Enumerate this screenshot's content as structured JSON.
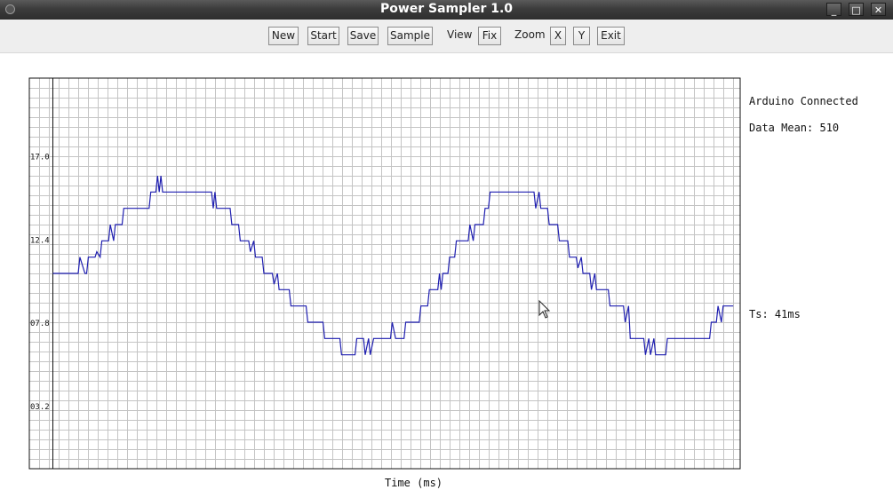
{
  "window": {
    "title": "Power Sampler 1.0",
    "controls": {
      "minimize": "_",
      "maximize": "□",
      "close": "✕"
    }
  },
  "toolbar": {
    "new_label": "New",
    "start_label": "Start",
    "save_label": "Save",
    "sample_label": "Sample",
    "view_label": "View",
    "fix_label": "Fix",
    "zoom_label": "Zoom",
    "x_label": "X",
    "y_label": "Y",
    "exit_label": "Exit"
  },
  "status": {
    "connection": "Arduino Connected",
    "data_mean": "Data Mean: 510",
    "sample_time": "Ts: 41ms"
  },
  "chart_data": {
    "type": "line",
    "xlabel": "Time (ms)",
    "ylabel": "",
    "ylim": [
      0,
      21.6
    ],
    "xlim": [
      0,
      39
    ],
    "y_ticks": [
      "03.2",
      "07.8",
      "12.4",
      "17.0"
    ],
    "y_tick_values": [
      3.2,
      7.8,
      12.4,
      17.0
    ],
    "grid": true,
    "series": [
      {
        "color": "#1f1fb0",
        "points": [
          [
            0,
            10.8
          ],
          [
            1.5,
            10.8
          ],
          [
            1.6,
            11.7
          ],
          [
            1.9,
            10.8
          ],
          [
            2.0,
            10.8
          ],
          [
            2.1,
            11.7
          ],
          [
            2.5,
            11.7
          ],
          [
            2.6,
            12.0
          ],
          [
            2.8,
            11.7
          ],
          [
            2.9,
            12.6
          ],
          [
            3.3,
            12.6
          ],
          [
            3.4,
            13.5
          ],
          [
            3.6,
            12.6
          ],
          [
            3.7,
            13.5
          ],
          [
            4.1,
            13.5
          ],
          [
            4.2,
            14.4
          ],
          [
            5.7,
            14.4
          ],
          [
            5.8,
            15.3
          ],
          [
            6.1,
            15.3
          ],
          [
            6.2,
            16.2
          ],
          [
            6.3,
            15.3
          ],
          [
            6.4,
            16.2
          ],
          [
            6.5,
            15.3
          ],
          [
            6.6,
            15.3
          ],
          [
            7.9,
            15.3
          ],
          [
            8.0,
            15.3
          ],
          [
            9.4,
            15.3
          ],
          [
            9.5,
            14.4
          ],
          [
            9.6,
            15.3
          ],
          [
            9.7,
            14.4
          ],
          [
            10.5,
            14.4
          ],
          [
            10.6,
            13.5
          ],
          [
            11.0,
            13.5
          ],
          [
            11.1,
            12.6
          ],
          [
            11.6,
            12.6
          ],
          [
            11.7,
            12.0
          ],
          [
            11.9,
            12.6
          ],
          [
            12.0,
            11.7
          ],
          [
            12.4,
            11.7
          ],
          [
            12.5,
            10.8
          ],
          [
            13.0,
            10.8
          ],
          [
            13.1,
            10.2
          ],
          [
            13.3,
            10.8
          ],
          [
            13.4,
            9.9
          ],
          [
            14.0,
            9.9
          ],
          [
            14.1,
            9.0
          ],
          [
            15.0,
            9.0
          ],
          [
            15.1,
            8.1
          ],
          [
            16.0,
            8.1
          ],
          [
            16.1,
            7.2
          ],
          [
            17.0,
            7.2
          ],
          [
            17.1,
            6.3
          ],
          [
            17.9,
            6.3
          ],
          [
            18.0,
            7.2
          ],
          [
            18.4,
            7.2
          ],
          [
            18.5,
            6.3
          ],
          [
            18.7,
            7.2
          ],
          [
            18.8,
            6.3
          ],
          [
            19.0,
            7.2
          ],
          [
            20.0,
            7.2
          ],
          [
            20.1,
            8.1
          ],
          [
            20.3,
            7.2
          ],
          [
            20.8,
            7.2
          ],
          [
            20.9,
            8.1
          ],
          [
            21.7,
            8.1
          ],
          [
            21.8,
            9.0
          ],
          [
            22.2,
            9.0
          ],
          [
            22.3,
            9.9
          ],
          [
            22.8,
            9.9
          ],
          [
            22.9,
            10.8
          ],
          [
            23.0,
            9.9
          ],
          [
            23.1,
            10.8
          ],
          [
            23.4,
            10.8
          ],
          [
            23.5,
            11.7
          ],
          [
            23.8,
            11.7
          ],
          [
            23.9,
            12.6
          ],
          [
            24.6,
            12.6
          ],
          [
            24.7,
            13.5
          ],
          [
            24.9,
            12.6
          ],
          [
            25.0,
            13.5
          ],
          [
            25.5,
            13.5
          ],
          [
            25.6,
            14.4
          ],
          [
            25.8,
            14.4
          ],
          [
            25.9,
            15.3
          ],
          [
            28.5,
            15.3
          ],
          [
            28.6,
            14.4
          ],
          [
            28.8,
            15.3
          ],
          [
            28.9,
            14.4
          ],
          [
            29.3,
            14.4
          ],
          [
            29.4,
            13.5
          ],
          [
            29.9,
            13.5
          ],
          [
            30.0,
            12.6
          ],
          [
            30.5,
            12.6
          ],
          [
            30.6,
            11.7
          ],
          [
            31.0,
            11.7
          ],
          [
            31.1,
            11.1
          ],
          [
            31.3,
            11.7
          ],
          [
            31.4,
            10.8
          ],
          [
            31.8,
            10.8
          ],
          [
            31.9,
            9.9
          ],
          [
            32.1,
            10.8
          ],
          [
            32.2,
            9.9
          ],
          [
            32.9,
            9.9
          ],
          [
            33.0,
            9.0
          ],
          [
            33.8,
            9.0
          ],
          [
            33.9,
            8.1
          ],
          [
            34.1,
            9.0
          ],
          [
            34.2,
            7.2
          ],
          [
            35.0,
            7.2
          ],
          [
            35.1,
            6.3
          ],
          [
            35.3,
            7.2
          ],
          [
            35.4,
            6.3
          ],
          [
            35.6,
            7.2
          ],
          [
            35.7,
            6.3
          ],
          [
            36.3,
            6.3
          ],
          [
            36.4,
            7.2
          ],
          [
            38.9,
            7.2
          ],
          [
            39.0,
            8.1
          ],
          [
            39.3,
            8.1
          ],
          [
            39.4,
            9.0
          ],
          [
            39.6,
            8.1
          ],
          [
            39.7,
            9.0
          ],
          [
            40.3,
            9.0
          ]
        ]
      }
    ]
  }
}
